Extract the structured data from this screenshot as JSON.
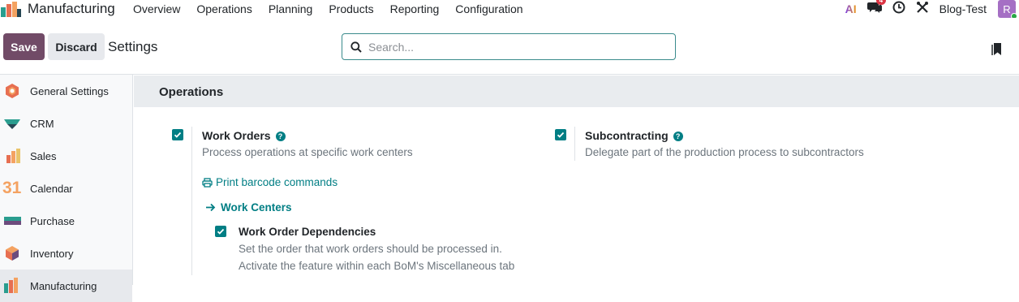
{
  "navbar": {
    "app_name": "Manufacturing",
    "menu": [
      "Overview",
      "Operations",
      "Planning",
      "Products",
      "Reporting",
      "Configuration"
    ],
    "ai_label": "AI",
    "messages_badge": "4",
    "company": "Blog-Test",
    "avatar_letter": "R"
  },
  "control_panel": {
    "save_label": "Save",
    "discard_label": "Discard",
    "title": "Settings",
    "search_placeholder": "Search..."
  },
  "sidebar": {
    "items": [
      {
        "label": "General Settings",
        "icon": "general-settings-icon"
      },
      {
        "label": "CRM",
        "icon": "crm-icon"
      },
      {
        "label": "Sales",
        "icon": "sales-icon"
      },
      {
        "label": "Calendar",
        "icon": "calendar-icon",
        "icon_text": "31"
      },
      {
        "label": "Purchase",
        "icon": "purchase-icon"
      },
      {
        "label": "Inventory",
        "icon": "inventory-icon"
      },
      {
        "label": "Manufacturing",
        "icon": "manufacturing-icon"
      }
    ]
  },
  "section": {
    "title": "Operations",
    "work_orders": {
      "title": "Work Orders",
      "description": "Process operations at specific work centers",
      "checked": true,
      "print_link": "Print barcode commands",
      "work_centers_link": "Work Centers",
      "dependencies": {
        "title": "Work Order Dependencies",
        "description_1": "Set the order that work orders should be processed in.",
        "description_2": "Activate the feature within each BoM's Miscellaneous tab",
        "checked": true
      }
    },
    "subcontracting": {
      "title": "Subcontracting",
      "description": "Delegate part of the production process to subcontractors",
      "checked": true
    }
  },
  "colors": {
    "primary": "#714b67",
    "accent": "#017e84"
  }
}
